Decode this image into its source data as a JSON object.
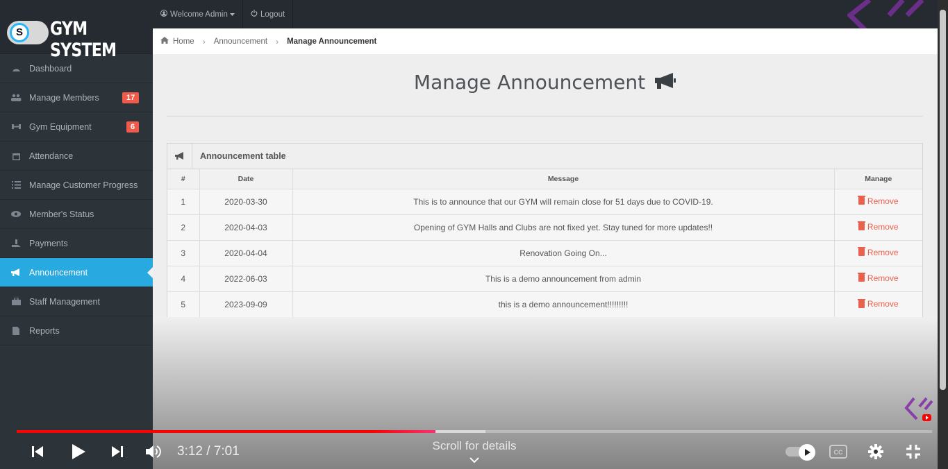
{
  "brand": {
    "badge_letter": "S",
    "title": "GYM SYSTEM"
  },
  "sidebar": {
    "items": [
      {
        "label": "Dashboard",
        "icon": "dashboard-icon"
      },
      {
        "label": "Manage Members",
        "icon": "users-icon",
        "badge": "17"
      },
      {
        "label": "Gym Equipment",
        "icon": "dumbbell-icon",
        "badge": "6"
      },
      {
        "label": "Attendance",
        "icon": "calendar-icon"
      },
      {
        "label": "Manage Customer Progress",
        "icon": "list-icon"
      },
      {
        "label": "Member's Status",
        "icon": "eye-icon"
      },
      {
        "label": "Payments",
        "icon": "hand-money-icon"
      },
      {
        "label": "Announcement",
        "icon": "bullhorn-icon",
        "active": true
      },
      {
        "label": "Staff Management",
        "icon": "briefcase-icon"
      },
      {
        "label": "Reports",
        "icon": "file-icon"
      }
    ]
  },
  "topbar": {
    "welcome": "Welcome Admin",
    "logout": "Logout"
  },
  "breadcrumb": {
    "home": "Home",
    "parent": "Announcement",
    "current": "Manage Announcement"
  },
  "main": {
    "title": "Manage Announcement"
  },
  "table": {
    "title": "Announcement table",
    "headers": [
      "#",
      "Date",
      "Message",
      "Manage"
    ],
    "remove_label": "Remove",
    "rows": [
      {
        "num": "1",
        "date": "2020-03-30",
        "message": "This is to announce that our GYM will remain close for 51 days due to COVID-19."
      },
      {
        "num": "2",
        "date": "2020-04-03",
        "message": "Opening of GYM Halls and Clubs are not fixed yet. Stay tuned for more updates!!"
      },
      {
        "num": "3",
        "date": "2020-04-04",
        "message": "Renovation Going On..."
      },
      {
        "num": "4",
        "date": "2022-06-03",
        "message": "This is a demo announcement from admin"
      },
      {
        "num": "5",
        "date": "2023-09-09",
        "message": "this is a demo announcement!!!!!!!!!"
      }
    ]
  },
  "player": {
    "time": "3:12 / 7:01",
    "scroll_hint": "Scroll for details",
    "played_fraction": 0.4575,
    "buffered_fraction": 0.512
  },
  "colors": {
    "accent": "#28a9e0",
    "badge": "#ef5a4a",
    "remove": "#e9604d",
    "progress": "#ff0000"
  }
}
